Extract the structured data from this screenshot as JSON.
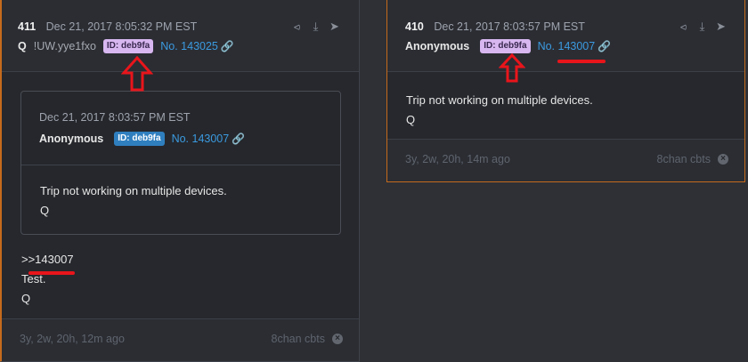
{
  "posts": [
    {
      "number": "411",
      "date": "Dec 21, 2017 8:05:32 PM EST",
      "name": "Q",
      "tripcode": "!UW.yye1fxo",
      "id_badge": "ID: deb9fa",
      "post_no": "No. 143025",
      "quoted_post": {
        "date": "Dec 21, 2017 8:03:57 PM EST",
        "name": "Anonymous",
        "id_badge": "ID: deb9fa",
        "post_no": "No. 143007",
        "lines": [
          "Trip not working on multiple devices.",
          "Q"
        ]
      },
      "reply_link": ">>143007",
      "lines": [
        "Test.",
        "Q"
      ],
      "footer_age": "3y, 2w, 20h, 12m ago",
      "footer_source": "8chan cbts"
    },
    {
      "number": "410",
      "date": "Dec 21, 2017 8:03:57 PM EST",
      "name": "Anonymous",
      "id_badge": "ID: deb9fa",
      "post_no": "No. 143007",
      "lines": [
        "Trip not working on multiple devices.",
        "Q"
      ],
      "footer_age": "3y, 2w, 20h, 14m ago",
      "footer_source": "8chan cbts"
    }
  ],
  "icons": [
    "share-icon",
    "download-icon",
    "arrow-right-circle-icon",
    "link-icon",
    "close-circle-icon"
  ],
  "colors": {
    "accent_orange": "#c56a1c",
    "link_blue": "#3b9ae0",
    "id_badge_purple": "#d8b7f0",
    "id_badge_blue": "#2f7fbf",
    "annotation_red": "#e8151b"
  }
}
